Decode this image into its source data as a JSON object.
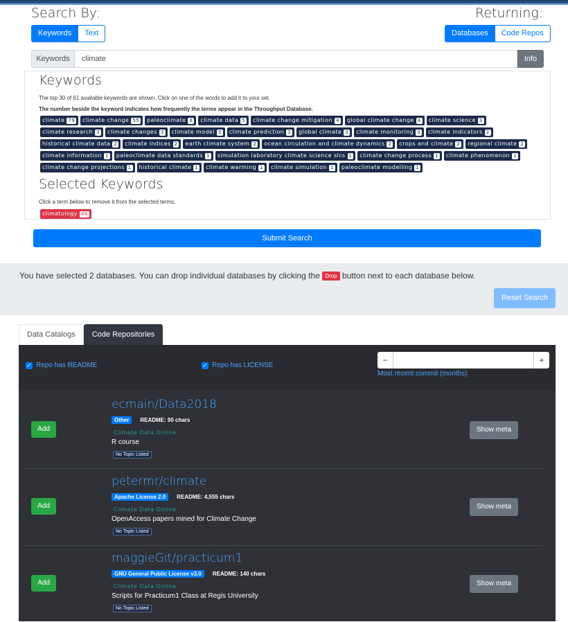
{
  "search_by": {
    "label": "Search By:",
    "options": [
      "Keywords",
      "Text"
    ]
  },
  "returning": {
    "label": "Returning:",
    "options": [
      "Databases",
      "Code Repos"
    ]
  },
  "search": {
    "prepend": "Keywords",
    "value": "climate",
    "info_label": "Info"
  },
  "keywords": {
    "title": "Keywords",
    "note": "The top 30 of 61 available keywords are shown. Click on one of the words to add it to your set.",
    "note_bold": "The number beside the keyword indicates how frequently the terms appear in the Throughput Database.",
    "items": [
      {
        "term": "climate",
        "count": "79"
      },
      {
        "term": "climate change",
        "count": "55"
      },
      {
        "term": "paleoclimate",
        "count": "8"
      },
      {
        "term": "climate data",
        "count": "5"
      },
      {
        "term": "climate change mitigation",
        "count": "4"
      },
      {
        "term": "global climate change",
        "count": "4"
      },
      {
        "term": "climate science",
        "count": "3"
      },
      {
        "term": "climate research",
        "count": "3"
      },
      {
        "term": "climate changes",
        "count": "3"
      },
      {
        "term": "climate model",
        "count": "3"
      },
      {
        "term": "climate prediction",
        "count": "3"
      },
      {
        "term": "global climate",
        "count": "3"
      },
      {
        "term": "climate monitoring",
        "count": "3"
      },
      {
        "term": "climate indicators",
        "count": "2"
      },
      {
        "term": "historical climate data",
        "count": "2"
      },
      {
        "term": "climate indices",
        "count": "2"
      },
      {
        "term": "earth climate system",
        "count": "2"
      },
      {
        "term": "ocean circulation and climate dynamics",
        "count": "2"
      },
      {
        "term": "crops and climate",
        "count": "2"
      },
      {
        "term": "regional climate",
        "count": "2"
      },
      {
        "term": "climate information",
        "count": "1"
      },
      {
        "term": "paleoclimate data standards",
        "count": "1"
      },
      {
        "term": "simulation laboratory climate science slcs",
        "count": "1"
      },
      {
        "term": "climate change process",
        "count": "1"
      },
      {
        "term": "climate phenomenon",
        "count": "1"
      },
      {
        "term": "climate change projections",
        "count": "1"
      },
      {
        "term": "historical climate",
        "count": "1"
      },
      {
        "term": "climate warming",
        "count": "1"
      },
      {
        "term": "climate simulation",
        "count": "1"
      },
      {
        "term": "paleoclimate modelling",
        "count": "1"
      }
    ]
  },
  "selected": {
    "title": "Selected Keywords",
    "note": "Click a term below to remove it from the selected terms.",
    "items": [
      {
        "term": "climatology",
        "count": "46"
      }
    ]
  },
  "submit_label": "Submit Search",
  "info": {
    "text_before": "You have selected 2 databases. You can drop individual databases by clicking the",
    "drop_label": "Drop",
    "text_after": "button next to each database below.",
    "reset_label": "Reset Search"
  },
  "tabs": [
    "Data Catalogs",
    "Code Repositories"
  ],
  "filters": {
    "readme": "Repo has README",
    "license": "Repo has LICENSE",
    "stepper_minus": "−",
    "stepper_plus": "+",
    "commit_label": "Most recent commit (months)"
  },
  "repos": [
    {
      "name": "ecmain/Data2018",
      "license": "Other",
      "readme": "README: 90 chars",
      "source": "Climate Data Online",
      "description": "R course",
      "topic": "No Topic Listed",
      "add": "Add",
      "show": "Show meta"
    },
    {
      "name": "petermr/climate",
      "license": "Apache License 2.0",
      "readme": "README: 4,555 chars",
      "source": "Climate Data Online",
      "description": "OpenAccess papers mined for Climate Change",
      "topic": "No Topic Listed",
      "add": "Add",
      "show": "Show meta"
    },
    {
      "name": "maggieGit/practicum1",
      "license": "GNU General Public License v3.0",
      "readme": "README: 140 chars",
      "source": "Climate Data Online",
      "description": "Scripts for Practicum1 Class at Regis University",
      "topic": "No Topic Listed",
      "add": "Add",
      "show": "Show meta"
    }
  ],
  "colors": {
    "primary": "#007bff",
    "tag_bg": "#1b2a4a",
    "danger": "#dc3545",
    "success": "#28a745",
    "panel": "#2f3136"
  }
}
